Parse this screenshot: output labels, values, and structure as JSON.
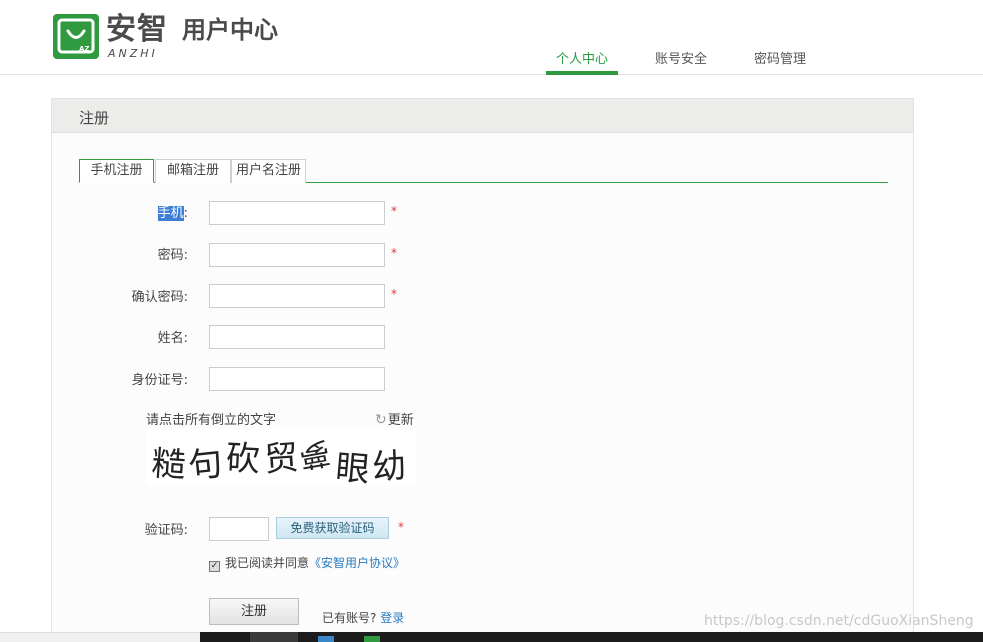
{
  "header": {
    "logo_icon": "shopping-bag-icon",
    "logo_badge": "AZ",
    "logo_cn": "安智",
    "logo_en": "ANZHI",
    "logo_sub": "用户中心",
    "nav": [
      {
        "label": "个人中心",
        "active": true
      },
      {
        "label": "账号安全",
        "active": false
      },
      {
        "label": "密码管理",
        "active": false
      }
    ],
    "accent_color": "#2f9a3f"
  },
  "panel": {
    "title": "注册",
    "tabs": [
      {
        "label": "手机注册",
        "active": true
      },
      {
        "label": "邮箱注册",
        "active": false
      },
      {
        "label": "用户名注册",
        "active": false
      }
    ]
  },
  "form": {
    "phone_label_hl": "手机",
    "phone_label_rest": ":",
    "password_label": "密码:",
    "confirm_label": "确认密码:",
    "name_label": "姓名:",
    "id_label": "身份证号:",
    "required_mark": "*",
    "phone_value": "",
    "password_value": "",
    "confirm_value": "",
    "name_value": "",
    "id_value": ""
  },
  "captcha": {
    "hint": "请点击所有倒立的文字",
    "refresh_icon": "refresh-icon",
    "refresh_label": "更新",
    "chars": [
      "糙",
      "句",
      "砍",
      "贸",
      "夢",
      "眼",
      "幼"
    ]
  },
  "verify": {
    "label": "验证码:",
    "value": "",
    "button": "免费获取验证码",
    "required_mark": "*"
  },
  "agree": {
    "checked": true,
    "text": "我已阅读并同意",
    "link": "《安智用户协议》"
  },
  "actions": {
    "register": "注册",
    "has_account": "已有账号?",
    "login": "登录"
  },
  "watermark": "https://blog.csdn.net/cdGuoXianSheng"
}
